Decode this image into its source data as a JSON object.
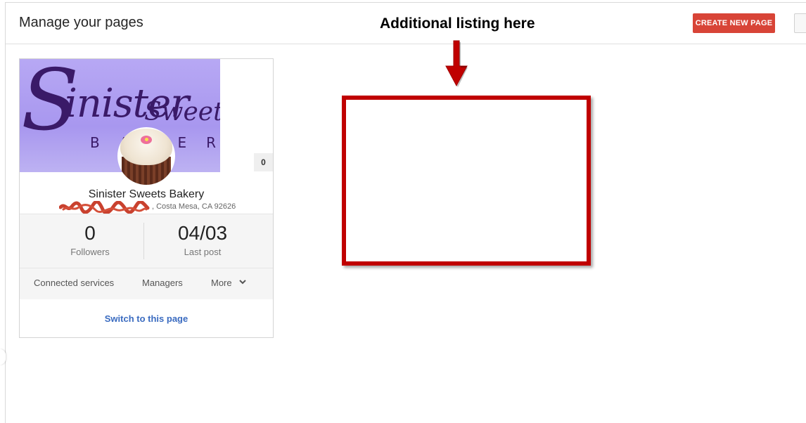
{
  "header": {
    "title": "Manage your pages",
    "create_button_label": "CREATE NEW PAGE"
  },
  "annotation": {
    "text": "Additional listing here",
    "accent_color": "#c00000"
  },
  "page_card": {
    "cover_logo": {
      "line1_initial": "S",
      "line1_rest": "inister",
      "line2": "Sweets",
      "line3": "BAKERY"
    },
    "count_badge": "0",
    "name": "Sinister Sweets Bakery",
    "address_suffix": ", Costa Mesa, CA 92626",
    "stats": [
      {
        "value": "0",
        "label": "Followers"
      },
      {
        "value": "04/03",
        "label": "Last post"
      }
    ],
    "actions": {
      "connected_services": "Connected services",
      "managers": "Managers",
      "more": "More"
    },
    "switch_link": "Switch to this page"
  },
  "colors": {
    "create_button": "#d84437",
    "link": "#3a6bc0",
    "cover_bg": "#a897ef"
  }
}
